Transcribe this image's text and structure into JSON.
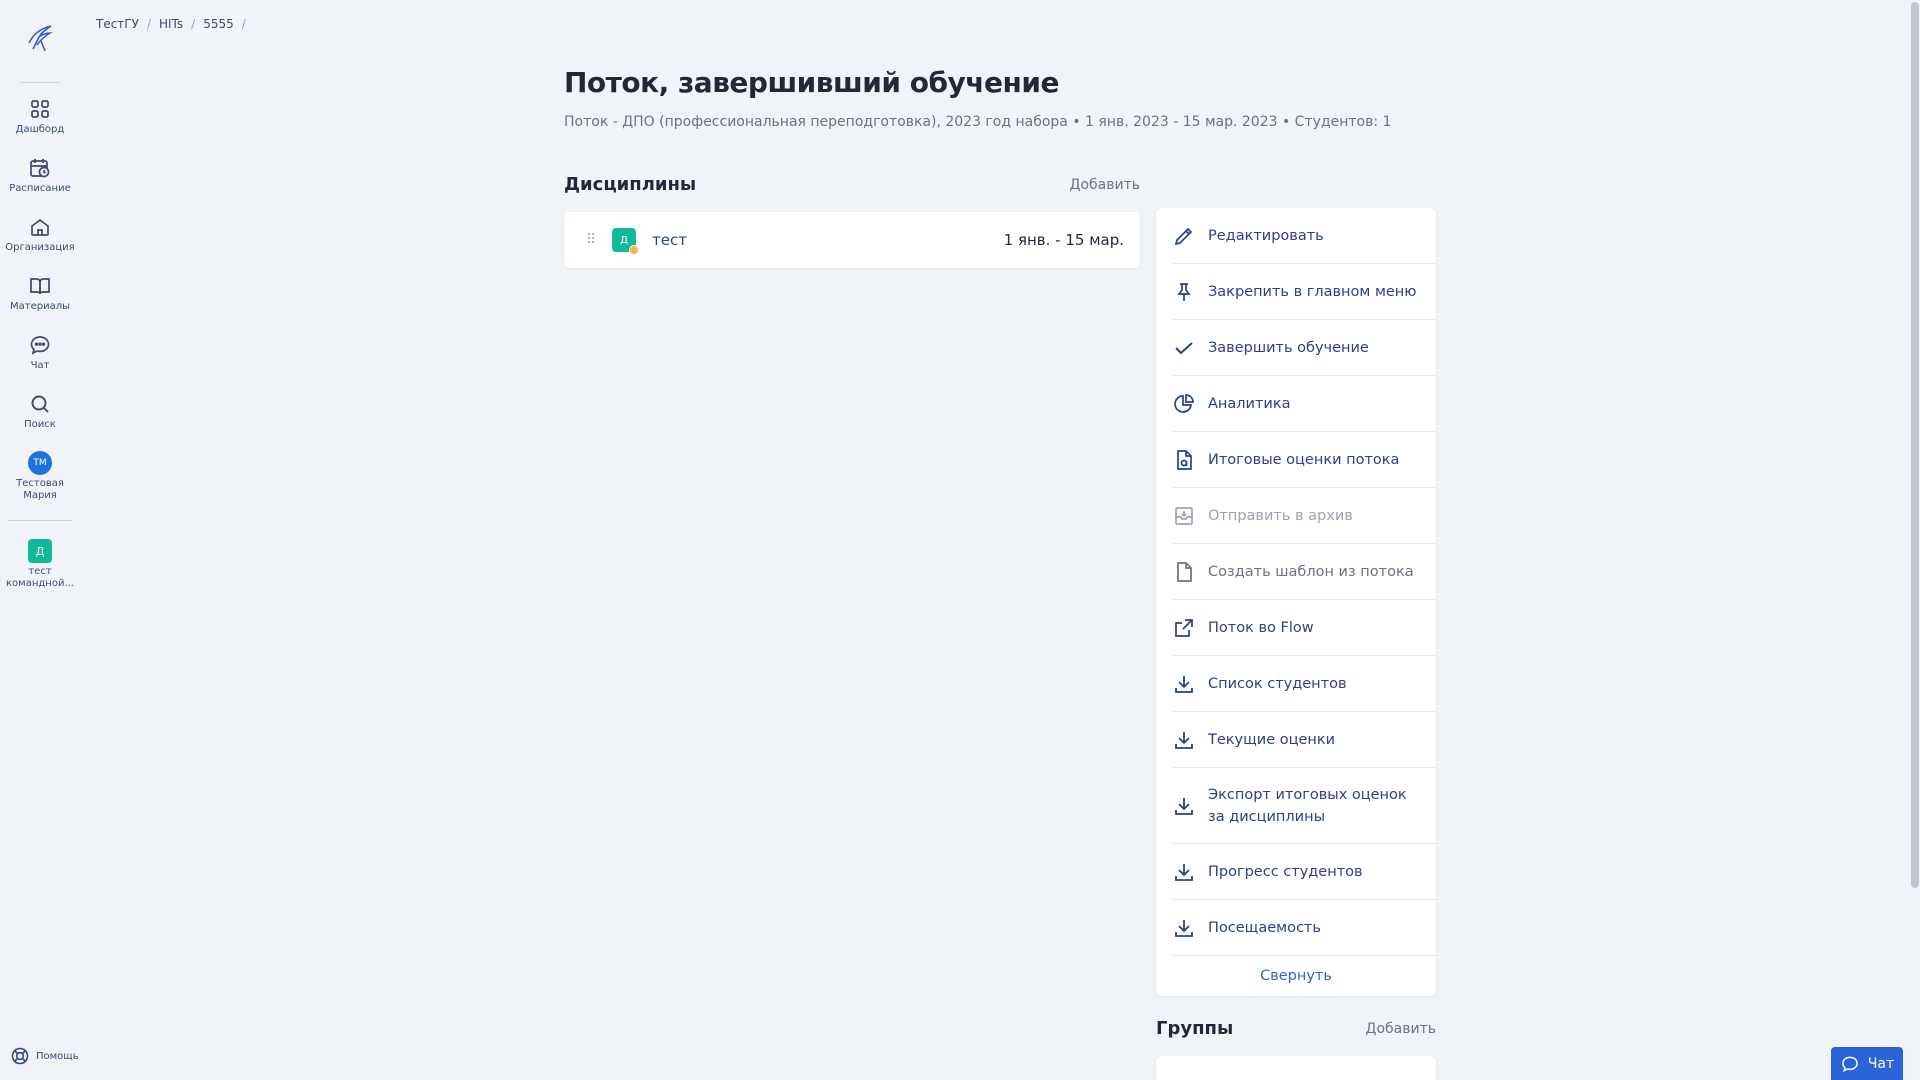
{
  "sidebar": {
    "items": [
      {
        "label": "Дашборд",
        "icon": "grid-icon"
      },
      {
        "label": "Расписание",
        "icon": "calendar-clock-icon"
      },
      {
        "label": "Организация",
        "icon": "home-icon"
      },
      {
        "label": "Материалы",
        "icon": "book-icon"
      },
      {
        "label": "Чат",
        "icon": "chat-icon"
      },
      {
        "label": "Поиск",
        "icon": "search-icon"
      }
    ],
    "user": {
      "initials": "ТМ",
      "label": "Тестовая Мария"
    },
    "team": {
      "initial": "Д",
      "label": "тест командной..."
    },
    "help_label": "Помощь"
  },
  "breadcrumb": [
    "ТестГУ",
    "HITs",
    "5555"
  ],
  "page": {
    "title": "Поток, завершивший обучение",
    "subtitle": "Поток - ДПО (профессиональная переподготовка), 2023 год набора • 1 янв. 2023 - 15 мар. 2023 • Студентов: 1"
  },
  "disciplines": {
    "heading": "Дисциплины",
    "add_label": "Добавить",
    "items": [
      {
        "badge": "Д",
        "name": "тест",
        "dates": "1 янв. - 15 мар."
      }
    ]
  },
  "menu": {
    "items": [
      {
        "label": "Редактировать",
        "icon": "pencil-icon",
        "state": "active"
      },
      {
        "label": "Закрепить в главном меню",
        "icon": "pin-icon",
        "state": "active"
      },
      {
        "label": "Завершить обучение",
        "icon": "check-icon",
        "state": "active"
      },
      {
        "label": "Аналитика",
        "icon": "pie-chart-icon",
        "state": "active"
      },
      {
        "label": "Итоговые оценки потока",
        "icon": "document-grade-icon",
        "state": "active"
      },
      {
        "label": "Отправить в архив",
        "icon": "archive-icon",
        "state": "disabled"
      },
      {
        "label": "Создать шаблон из потока",
        "icon": "file-icon",
        "state": "gray"
      },
      {
        "label": "Поток во Flow",
        "icon": "external-link-icon",
        "state": "active"
      },
      {
        "label": "Список студентов",
        "icon": "download-icon",
        "state": "active"
      },
      {
        "label": "Текущие оценки",
        "icon": "download-icon",
        "state": "active"
      },
      {
        "label": "Экспорт итоговых оценок за дисциплины",
        "icon": "download-icon",
        "state": "active"
      },
      {
        "label": "Прогресс студентов",
        "icon": "download-icon",
        "state": "active"
      },
      {
        "label": "Посещаемость",
        "icon": "download-icon",
        "state": "active"
      }
    ],
    "collapse_label": "Свернуть"
  },
  "groups": {
    "heading": "Группы",
    "add_label": "Добавить"
  },
  "chat_button": {
    "label": "Чат"
  },
  "colors": {
    "accent": "#2c3e8f",
    "link": "#2c64d8",
    "teal": "#10b99a",
    "background": "#f0f4f8"
  }
}
